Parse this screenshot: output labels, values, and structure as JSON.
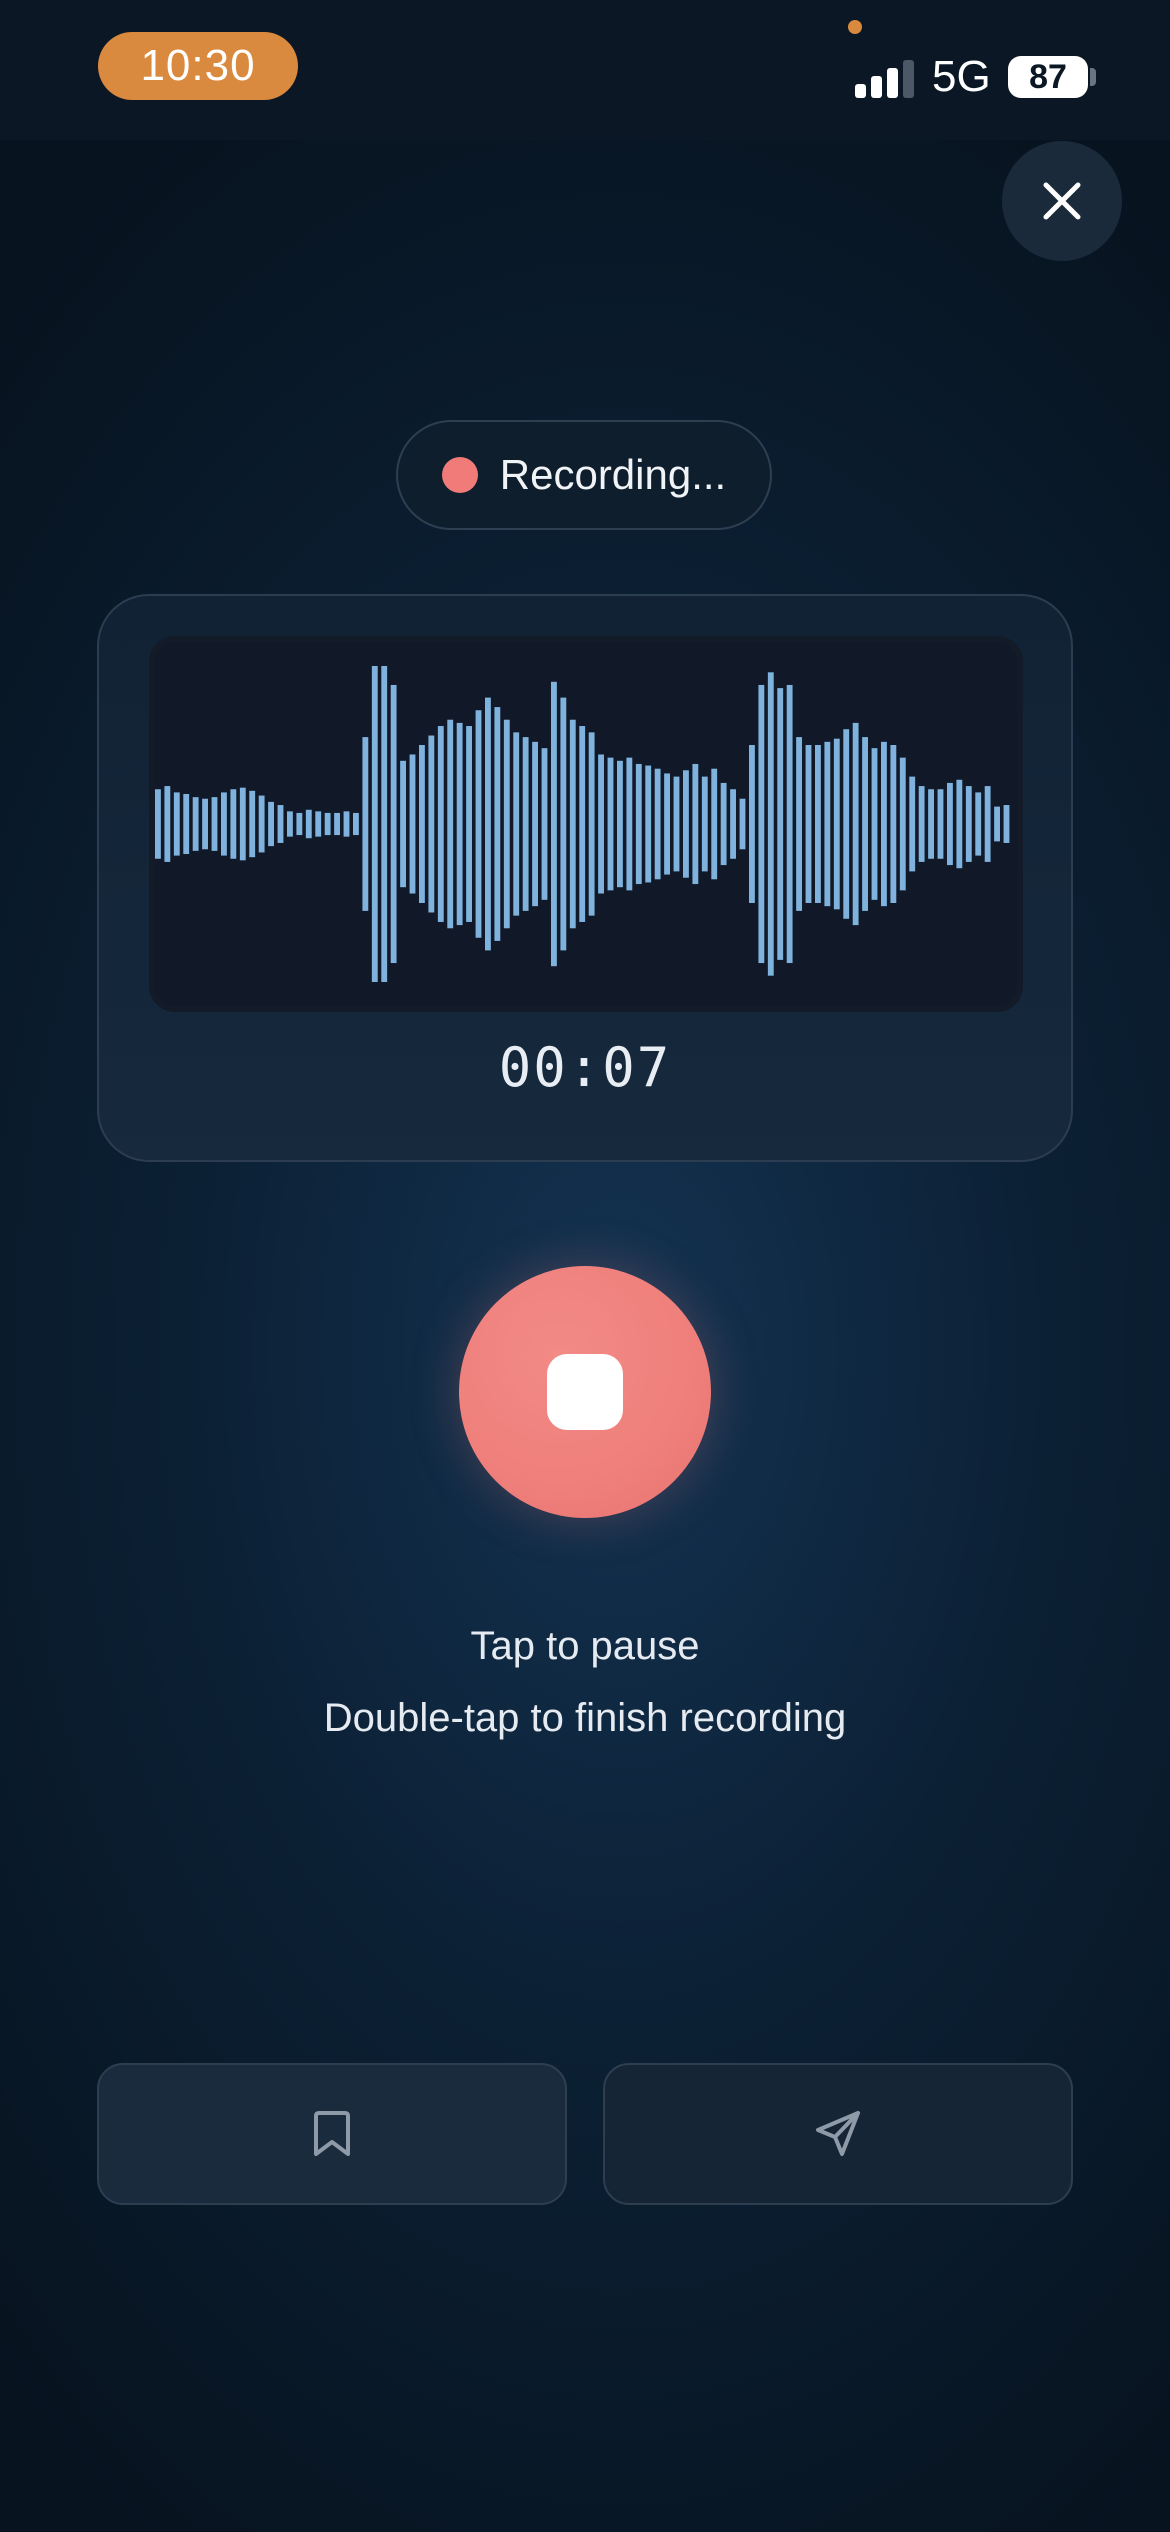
{
  "status_bar": {
    "time": "10:30",
    "network": "5G",
    "battery": "87"
  },
  "recording": {
    "status_label": "Recording...",
    "timer": "00:07",
    "waveform_levels": [
      0.22,
      0.24,
      0.2,
      0.19,
      0.17,
      0.16,
      0.17,
      0.2,
      0.22,
      0.23,
      0.21,
      0.18,
      0.14,
      0.12,
      0.08,
      0.07,
      0.09,
      0.08,
      0.07,
      0.07,
      0.08,
      0.07,
      0.55,
      1.0,
      1.0,
      0.88,
      0.4,
      0.44,
      0.5,
      0.56,
      0.62,
      0.66,
      0.64,
      0.62,
      0.72,
      0.8,
      0.74,
      0.66,
      0.58,
      0.55,
      0.52,
      0.48,
      0.9,
      0.8,
      0.66,
      0.62,
      0.58,
      0.44,
      0.42,
      0.4,
      0.42,
      0.38,
      0.37,
      0.35,
      0.32,
      0.3,
      0.34,
      0.38,
      0.3,
      0.35,
      0.26,
      0.22,
      0.16,
      0.5,
      0.88,
      0.96,
      0.86,
      0.88,
      0.55,
      0.5,
      0.5,
      0.52,
      0.54,
      0.6,
      0.64,
      0.55,
      0.48,
      0.52,
      0.5,
      0.42,
      0.3,
      0.24,
      0.22,
      0.22,
      0.26,
      0.28,
      0.24,
      0.2,
      0.24,
      0.11,
      0.12
    ],
    "waveform_color": "#7fb3de"
  },
  "hints": {
    "tap": "Tap to pause",
    "double_tap": "Double-tap to finish recording"
  },
  "colors": {
    "accent": "#ef7f7b",
    "time_pill": "#d98a3e"
  },
  "icons": {
    "close": "close-icon",
    "stop": "stop-icon",
    "save": "bookmark-icon",
    "send": "send-icon"
  }
}
